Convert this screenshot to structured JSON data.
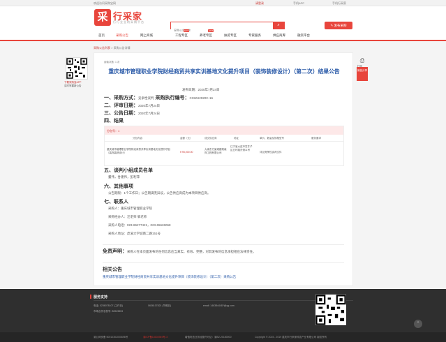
{
  "topbar": {
    "left": "欢迎访问采购宝网",
    "login": "请登录",
    "app": "手机APP",
    "wechat": "手机行采家"
  },
  "header": {
    "logo_char": "采",
    "logo_text": "行采家",
    "logo_sub": "行行业业的采购平台",
    "search_placeholder": "采购公告名称",
    "search_icon": "search-icon",
    "post_button": "发布采购"
  },
  "nav": {
    "items": [
      "首页",
      "采购公告",
      "网上商城",
      "工程专区",
      "养老专区",
      "扶贫专区",
      "专家服务",
      "供应商库",
      "融资平台"
    ],
    "hot": [
      "HOT",
      "HOT"
    ]
  },
  "breadcrumb": {
    "root": "采购公告列表",
    "sep": ">",
    "current": "采购公告详情"
  },
  "left_qr": {
    "line1": "下载采购宝APP",
    "line2": "实时掌握新公告"
  },
  "side": {
    "print_icon": "printer-icon",
    "print_label": "打印",
    "share": "微信分享"
  },
  "notice": {
    "views": "阅读次数: 1 次",
    "title": "重庆城市管理职业学院财经商贸共享实训基地文化提升项目（装饰装修设计）（第二次）结果公告",
    "pubdate": "发布日期：2020年7月24日",
    "sec1_label": "一、采购方式：",
    "sec1_value": "竞争性谈判",
    "sec1_code_label": "采购执行编号：",
    "sec1_code": "CSWU2020C-16",
    "sec2_label": "二、评审日期：",
    "sec2_value": "2020年7月24日",
    "sec3_label": "三、公告日期：",
    "sec3_value": "2020年7月24日",
    "sec4_label": "四、结果",
    "table": {
      "package": "分包号：1",
      "columns": [
        "分包内容",
        "金额（元）",
        "成交供应商",
        "地址",
        "单价、数量及规格型号",
        "服务要求"
      ],
      "row": {
        "content": "重庆城市管理职业学院财经商贸共享实训基地文化提升项目（装饰装修设计）",
        "amount": "¥ 95,000.00",
        "supplier": "大渝东方景观建筑装饰工程有限公司",
        "address": "辽宁省大连市甘井子区五环路东侧11号",
        "spec": "详见竞争性谈判文件",
        "service": ""
      }
    },
    "sec5_label": "五、谈判小组成员名单",
    "sec5_value": "董伟，甘建伟，彭利萍",
    "sec6_label": "六、其他事项",
    "sec6_value": "公告期限：1个工作日；公告期满无异议，公告供应商成为本项目供应商。",
    "sec7_label": "七、联系人",
    "contacts": [
      "采购人：重庆城市管理职业学院",
      "采购经办人：汪老师 黎老师",
      "采购人电话：023-86277421，023-65626068",
      "采购人地址：虎溪大学城南二路151号"
    ],
    "disclaimer_label": "免责声明：",
    "disclaimer": "采购人在本页面发布的任何信息应当真实、有效、完整，对其发布的信息承担相应法律责任。",
    "related_title": "相关公告",
    "related_link": "重庆城市管理职业学院财经商贸共享实训基地文化提升项目（装饰装修设计）（第二次）采购公告"
  },
  "footer": {
    "title": "服务支持",
    "phone": "电话: 0236078107 (工作日)",
    "phone2": "0636107821 (节假日)",
    "email": "email: 146384448?@qq.com",
    "address": "市场合作总机号: 83949803",
    "bottom_items": [
      "渝公网安备 50010302000696号",
      "渝ICP备14004949号-3",
      "增值电信业务经营许可证：渝B2-20180000"
    ],
    "copyright": "Copyright © 2015 - 2019 重庆市行采家科技产业有限公司 版权所有"
  },
  "colors": {
    "accent": "#e8453c",
    "link": "#2a5aa8"
  }
}
